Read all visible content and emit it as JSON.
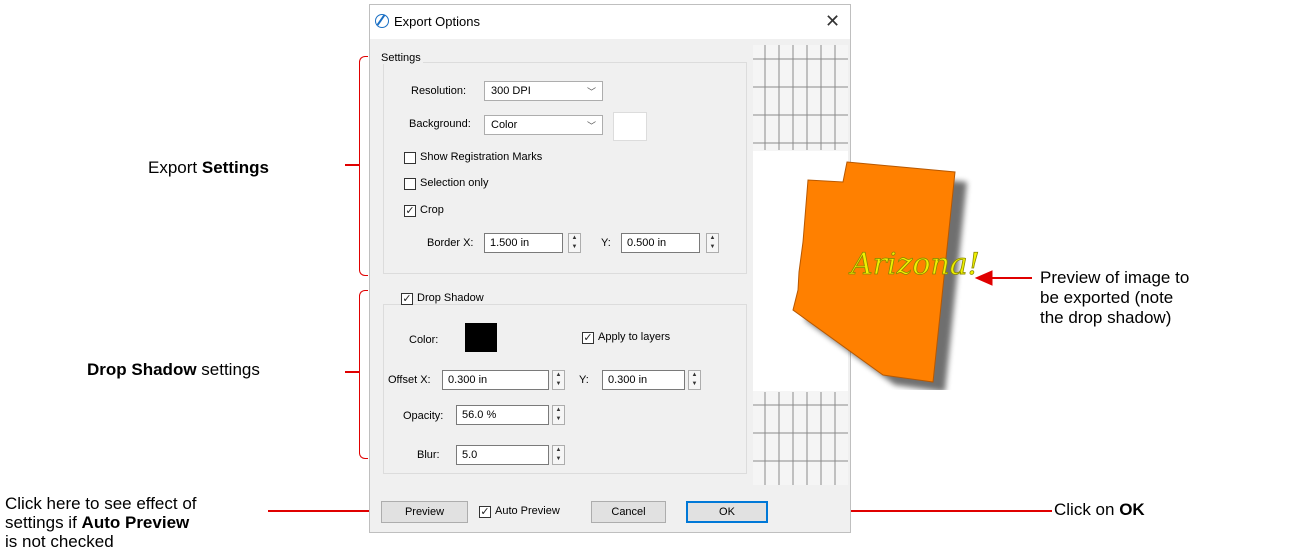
{
  "dialog": {
    "title": "Export Options",
    "settings_group": {
      "legend": "Settings",
      "resolution_label": "Resolution:",
      "resolution_value": "300 DPI",
      "background_label": "Background:",
      "background_value": "Color",
      "show_registration_marks": {
        "label": "Show Registration Marks",
        "checked": false
      },
      "selection_only": {
        "label": "Selection only",
        "checked": false
      },
      "crop": {
        "label": "Crop",
        "checked": true
      },
      "border_x_label": "Border X:",
      "border_x_value": "1.500 in",
      "border_y_label": "Y:",
      "border_y_value": "0.500 in"
    },
    "drop_shadow_group": {
      "enabled": {
        "label": "Drop Shadow",
        "checked": true
      },
      "color_label": "Color:",
      "apply_to_layers": {
        "label": "Apply to layers",
        "checked": true
      },
      "offset_x_label": "Offset X:",
      "offset_x_value": "0.300 in",
      "offset_y_label": "Y:",
      "offset_y_value": "0.300 in",
      "opacity_label": "Opacity:",
      "opacity_value": "56.0 %",
      "blur_label": "Blur:",
      "blur_value": "5.0"
    },
    "buttons": {
      "preview": "Preview",
      "auto_preview": {
        "label": "Auto Preview",
        "checked": true
      },
      "cancel": "Cancel",
      "ok": "OK"
    },
    "preview_image_text": "Arizona!"
  },
  "annotations": {
    "export_settings": {
      "prefix": "Export ",
      "bold": "Settings"
    },
    "drop_shadow_settings": {
      "bold": "Drop Shadow",
      "suffix": " settings"
    },
    "preview_note": [
      "Preview of image to",
      "be exported (note",
      "the drop shadow)"
    ],
    "click_here": {
      "line1": "Click here to see effect of",
      "line2_prefix": "settings if ",
      "line2_bold": "Auto Preview",
      "line3": "is not checked"
    },
    "click_ok": {
      "prefix": "Click on ",
      "bold": "OK"
    }
  },
  "colors": {
    "annotation_red": "#e00000",
    "accent_blue": "#0078d7",
    "shape_orange": "#ff8000",
    "text_yellow": "#f0f000"
  }
}
